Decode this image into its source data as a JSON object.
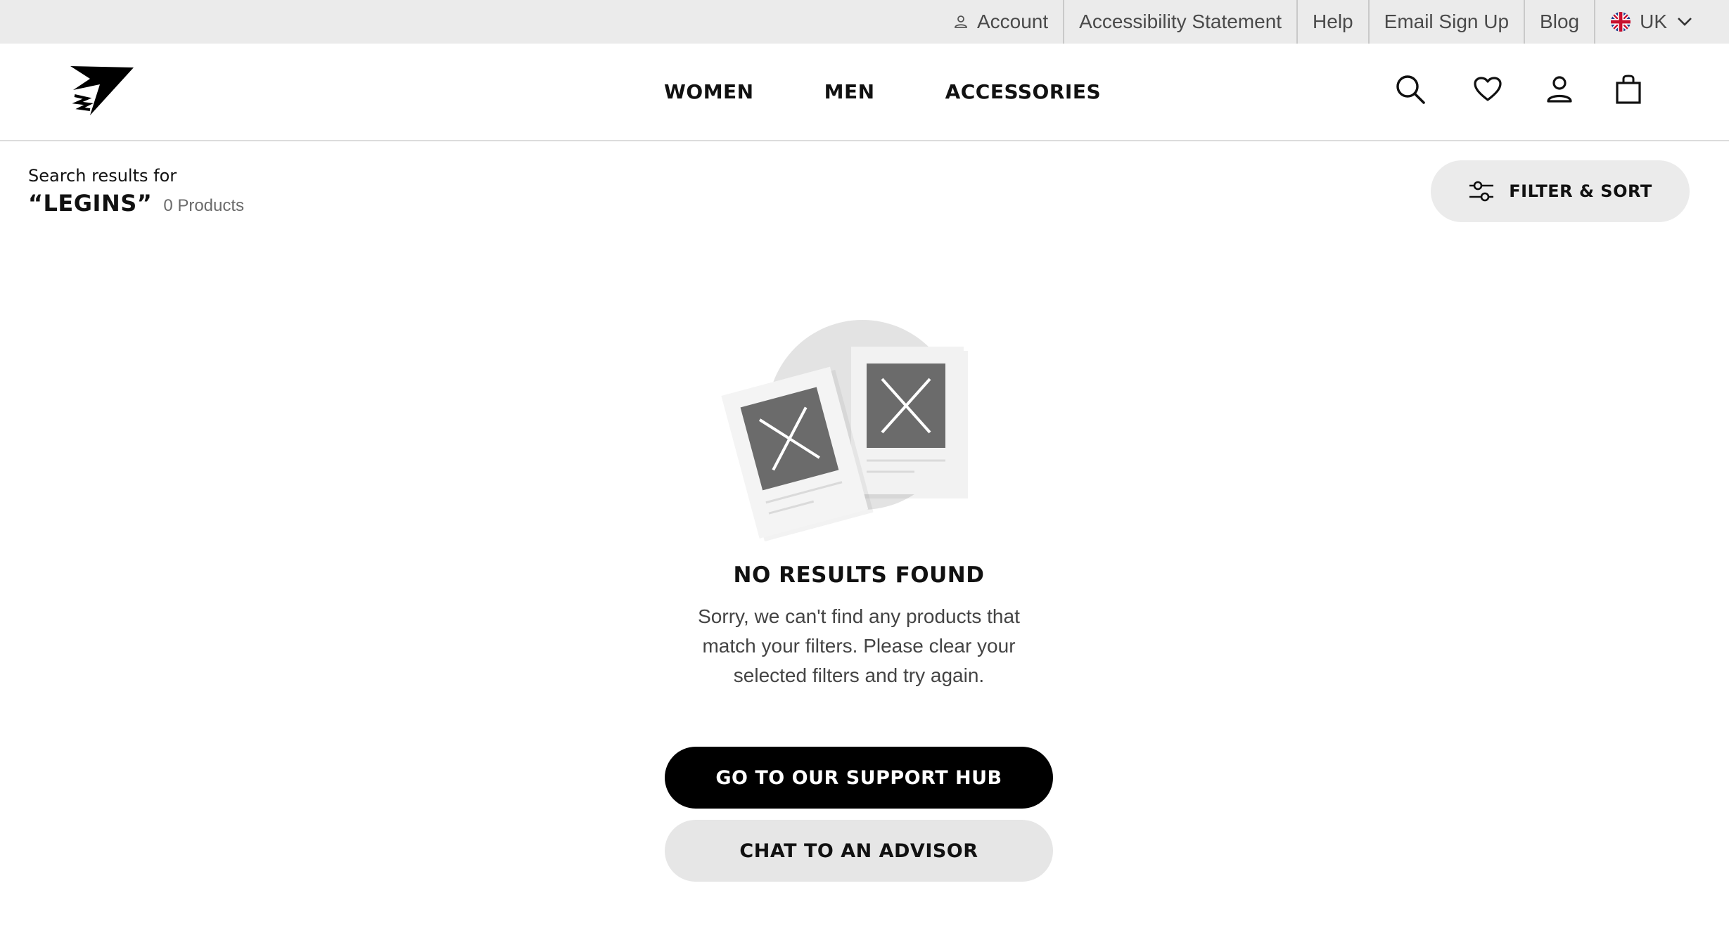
{
  "utility_bar": {
    "links": [
      {
        "label": "Account"
      },
      {
        "label": "Accessibility Statement"
      },
      {
        "label": "Help"
      },
      {
        "label": "Email Sign Up"
      },
      {
        "label": "Blog"
      },
      {
        "label": "UK"
      }
    ],
    "icons": {
      "account": "person-outline-icon",
      "region": "uk-flag-icon",
      "dropdown": "chevron-down-icon"
    }
  },
  "header": {
    "logo": "gymshark-shark-logo",
    "nav": [
      "WOMEN",
      "MEN",
      "ACCESSORIES"
    ],
    "icons": [
      "search-icon",
      "heart-icon",
      "user-icon",
      "bag-icon"
    ]
  },
  "search": {
    "label": "Search results for",
    "term": "“LEGINS”",
    "count": "0 Products"
  },
  "filter": {
    "label": "FILTER & SORT",
    "icon": "sliders-icon"
  },
  "empty_state": {
    "title": "NO RESULTS FOUND",
    "message": "Sorry, we can't find any products that match your filters. Please clear your selected filters and try again.",
    "primary_button": "GO TO OUR SUPPORT HUB",
    "secondary_button": "CHAT TO AN ADVISOR"
  },
  "colors": {
    "utility_bg": "#ebebeb",
    "primary": "#000000",
    "secondary_btn": "#e6e6e6",
    "text": "#111111",
    "muted": "#6b6b6b"
  }
}
